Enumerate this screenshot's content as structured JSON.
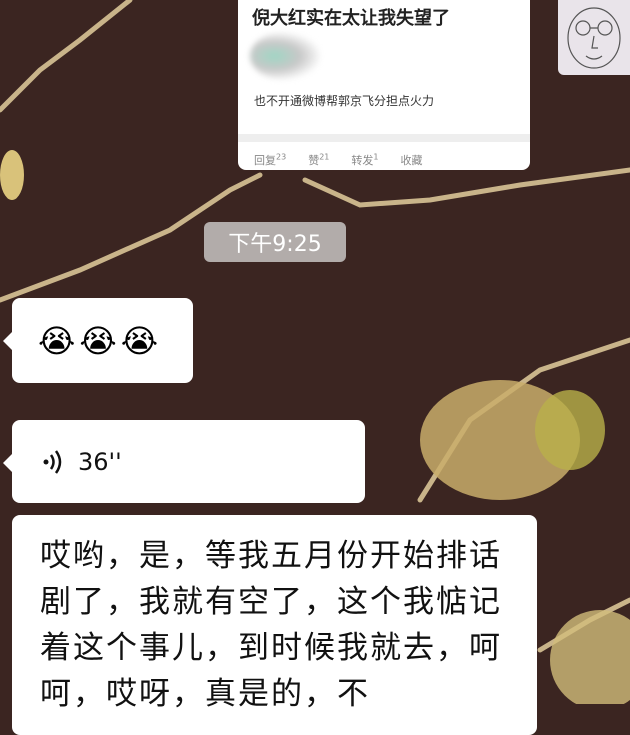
{
  "shared_card": {
    "title": "倪大红实在太让我失望了",
    "subtitle": "也不开通微博帮郭京飞分担点火力",
    "actions": [
      {
        "label": "回复",
        "count": "23"
      },
      {
        "label": "赞",
        "count": "21"
      },
      {
        "label": "转发",
        "count": "1"
      },
      {
        "label": "收藏",
        "count": ""
      }
    ]
  },
  "timestamp": "下午9:25",
  "messages": {
    "emoji": [
      "😭",
      "😭",
      "😭"
    ],
    "voice": {
      "icon": "voice-wave-icon",
      "duration": "36''"
    },
    "text": "哎哟，是，等我五月份开始排话剧了，我就有空了，这个我惦记着这个事儿，到时候我就去，呵呵，哎呀，真是的，不"
  },
  "colors": {
    "background": "#3b2521",
    "bubble": "#ffffff",
    "timestamp_bg": "#b2acaa"
  }
}
